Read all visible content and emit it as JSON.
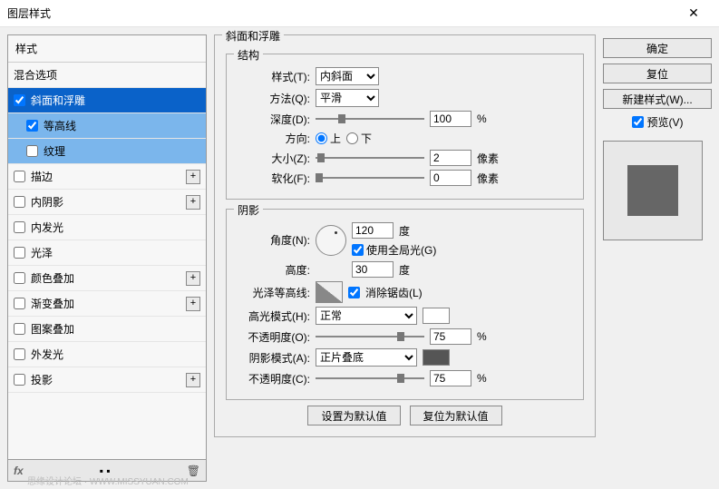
{
  "window": {
    "title": "图层样式",
    "close": "✕"
  },
  "sidebar": {
    "header": "样式",
    "blending": "混合选项",
    "items": [
      {
        "label": "斜面和浮雕",
        "checked": true,
        "selected": true,
        "plus": false,
        "lvl": 1
      },
      {
        "label": "等高线",
        "checked": true,
        "selected": false,
        "subsel": true,
        "plus": false,
        "lvl": 2
      },
      {
        "label": "纹理",
        "checked": false,
        "selected": false,
        "subsel": true,
        "plus": false,
        "lvl": 2
      },
      {
        "label": "描边",
        "checked": false,
        "plus": true,
        "lvl": 1
      },
      {
        "label": "内阴影",
        "checked": false,
        "plus": true,
        "lvl": 1
      },
      {
        "label": "内发光",
        "checked": false,
        "plus": false,
        "lvl": 1
      },
      {
        "label": "光泽",
        "checked": false,
        "plus": false,
        "lvl": 1
      },
      {
        "label": "颜色叠加",
        "checked": false,
        "plus": true,
        "lvl": 1
      },
      {
        "label": "渐变叠加",
        "checked": false,
        "plus": true,
        "lvl": 1
      },
      {
        "label": "图案叠加",
        "checked": false,
        "plus": false,
        "lvl": 1
      },
      {
        "label": "外发光",
        "checked": false,
        "plus": false,
        "lvl": 1
      },
      {
        "label": "投影",
        "checked": false,
        "plus": true,
        "lvl": 1
      }
    ],
    "fx": "fx",
    "trash": "🗑"
  },
  "panel": {
    "group_title": "斜面和浮雕",
    "structure": {
      "title": "结构",
      "style_label": "样式(T):",
      "style_value": "内斜面",
      "technique_label": "方法(Q):",
      "technique_value": "平滑",
      "depth_label": "深度(D):",
      "depth_value": "100",
      "depth_unit": "%",
      "direction_label": "方向:",
      "up": "上",
      "down": "下",
      "size_label": "大小(Z):",
      "size_value": "2",
      "size_unit": "像素",
      "soften_label": "软化(F):",
      "soften_value": "0",
      "soften_unit": "像素"
    },
    "shading": {
      "title": "阴影",
      "angle_label": "角度(N):",
      "angle_value": "120",
      "angle_unit": "度",
      "global_label": "使用全局光(G)",
      "altitude_label": "高度:",
      "altitude_value": "30",
      "altitude_unit": "度",
      "gloss_label": "光泽等高线:",
      "antialias_label": "消除锯齿(L)",
      "highlight_label": "高光模式(H):",
      "highlight_value": "正常",
      "opacity1_label": "不透明度(O):",
      "opacity1_value": "75",
      "opacity1_unit": "%",
      "shadow_label": "阴影模式(A):",
      "shadow_value": "正片叠底",
      "opacity2_label": "不透明度(C):",
      "opacity2_value": "75",
      "opacity2_unit": "%"
    },
    "make_default": "设置为默认值",
    "reset_default": "复位为默认值"
  },
  "right": {
    "ok": "确定",
    "reset": "复位",
    "newstyle": "新建样式(W)...",
    "preview": "预览(V)"
  },
  "watermark": "思缘设计论坛 · WWW.MISSYUAN.COM"
}
